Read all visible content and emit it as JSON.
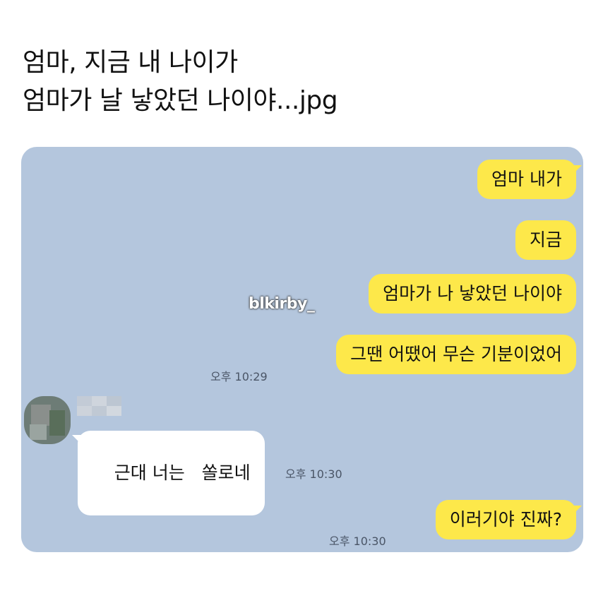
{
  "headline": {
    "line1": "엄마, 지금 내 나이가",
    "line2": "엄마가 날 낳았던 나이야...jpg"
  },
  "watermark": "blkirby_",
  "messages": [
    {
      "sender": "me",
      "text": "엄마 내가"
    },
    {
      "sender": "me",
      "text": "지금"
    },
    {
      "sender": "me",
      "text": "엄마가 나 낳았던 나이야"
    },
    {
      "sender": "me",
      "text": "그땐 어땠어 무슨 기분이었어"
    },
    {
      "sender": "other",
      "text": "근대 너는   쏠로네"
    },
    {
      "sender": "me",
      "text": "이러기야 진짜?"
    }
  ],
  "timestamps": [
    "오후 10:29",
    "오후 10:30",
    "오후 10:30"
  ],
  "colors": {
    "chat_background": "#b4c6dd",
    "my_bubble": "#fde84a",
    "other_bubble": "#ffffff"
  }
}
